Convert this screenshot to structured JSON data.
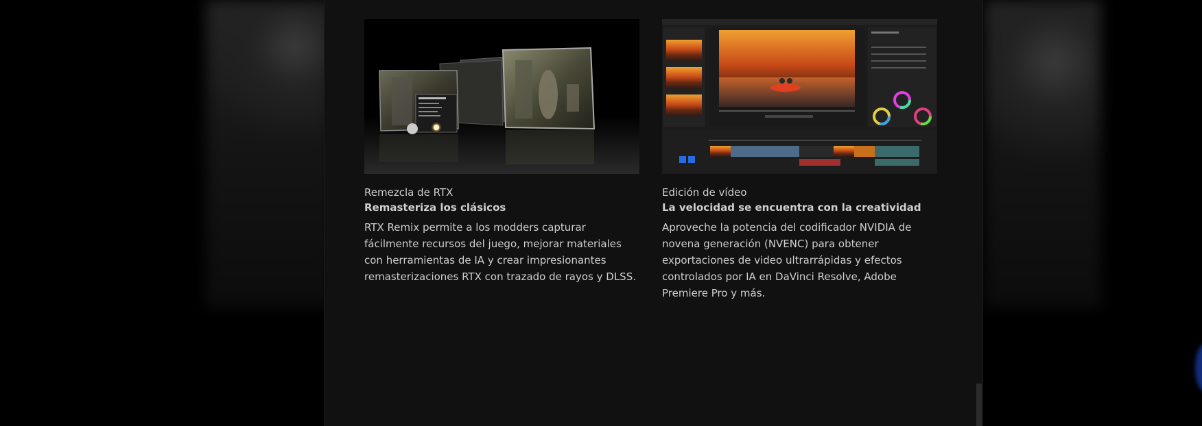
{
  "cards": [
    {
      "image_icon": "rtx-remix-image",
      "subtitle": "Remezcla de RTX",
      "heading": "Remasteriza los clásicos",
      "body": "RTX Remix permite a los modders capturar fácilmente recursos del juego, mejorar materiales con herramientas de IA y crear impresionantes remasterizaciones RTX con trazado de rayos y DLSS."
    },
    {
      "image_icon": "video-editing-image",
      "subtitle": "Edición de vídeo",
      "heading": "La velocidad se encuentra con la creatividad",
      "body": "Aproveche la potencia del codificador NVIDIA de novena generación (NVENC) para obtener exportaciones de video ultrarrápidas y efectos controlados por IA en DaVinci Resolve, Adobe Premiere Pro y más."
    }
  ],
  "colors": {
    "page_bg": "#000000",
    "modal_bg": "#111111",
    "text": "#cfcfcf"
  }
}
